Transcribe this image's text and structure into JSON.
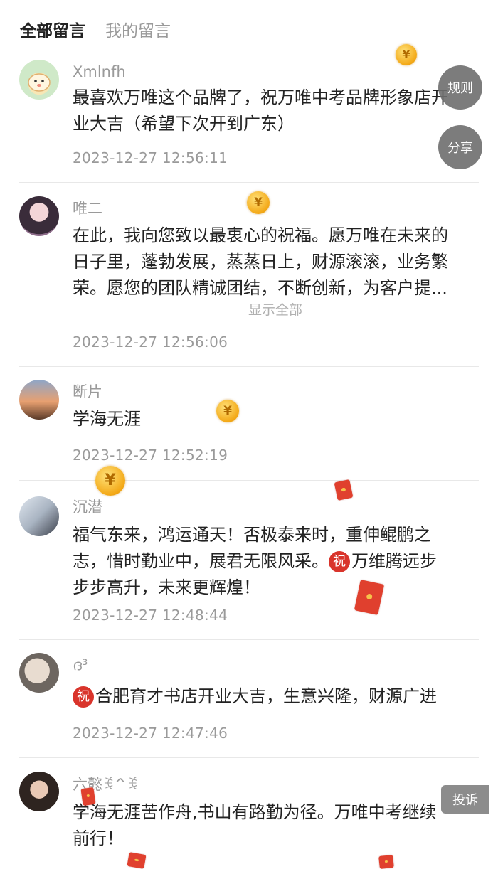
{
  "tabs": {
    "all": "全部留言",
    "mine": "我的留言"
  },
  "buttons": {
    "rules": "规则",
    "share": "分享",
    "report": "投诉",
    "expand": "显示全部"
  },
  "comments": [
    {
      "author": "Xmlnfh",
      "lines": [
        "最喜欢万唯这个品牌了，祝万唯中考品牌形象店开",
        "业大吉（希望下次开到广东）"
      ],
      "time": "2023-12-27 12:56:11"
    },
    {
      "author": "唯二",
      "lines": [
        "在此，我向您致以最衷心的祝福。愿万唯在未来的",
        "日子里，蓬勃发展，蒸蒸日上，财源滚滚，业务繁",
        "荣。愿您的团队精诚团结，不断创新，为客户提..."
      ],
      "time": "2023-12-27 12:56:06"
    },
    {
      "author": "断片",
      "lines": [
        "学海无涯"
      ],
      "time": "2023-12-27 12:52:19"
    },
    {
      "author": "沉潜",
      "lines": [
        "福气东来，鸿运通天！否极泰来时，重伸鲲鹏之",
        "志，惜时勤业中，展君无限风采。",
        "步步高升，未来更辉煌！"
      ],
      "badge_text": "万维腾远步",
      "time": "2023-12-27 12:48:44"
    },
    {
      "author": "ദ³",
      "text": "合肥育才书店开业大吉，生意兴隆，财源广进",
      "time": "2023-12-27 12:47:46"
    },
    {
      "author": "六懿ꉂ^ꉂ",
      "lines": [
        "学海无涯苦作舟,书山有路勤为径。万唯中考继续",
        "前行！"
      ]
    }
  ],
  "badge_glyph": "祝",
  "coin_glyph": "¥",
  "colors": {
    "coin": "#f3a816",
    "envelope": "#e0402e",
    "badge": "#d9342b"
  }
}
